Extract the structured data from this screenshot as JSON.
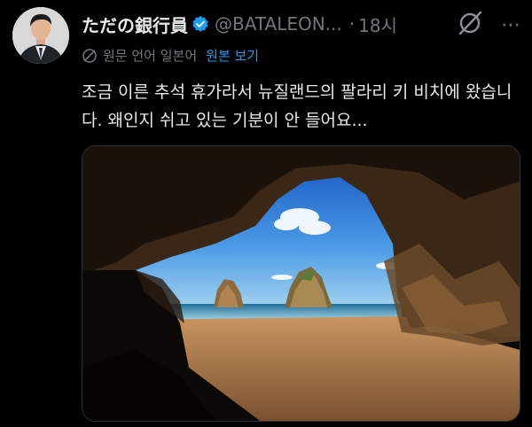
{
  "tweet": {
    "display_name": "ただの銀行員",
    "handle": "@BATALEON...",
    "separator": "·",
    "time": "18시",
    "translation": {
      "source_language_label": "원문 언어 일본어",
      "show_original_label": "원본 보기"
    },
    "text": "조금 이른 추석 휴가라서 뉴질랜드의 팔라리 키 비치에 왔습니다. 왜인지 쉬고 있는 기분이 안 들어요...",
    "media_alt": "cave-beach-photo"
  },
  "icons": {
    "verified": "verified-badge-icon",
    "grok": "grok-icon",
    "more": "more-icon",
    "translate": "globe-icon"
  },
  "colors": {
    "background": "#000000",
    "primary_text": "#e7e9ea",
    "secondary_text": "#71767b",
    "link": "#1d9bf0",
    "verified": "#1d9bf0"
  }
}
